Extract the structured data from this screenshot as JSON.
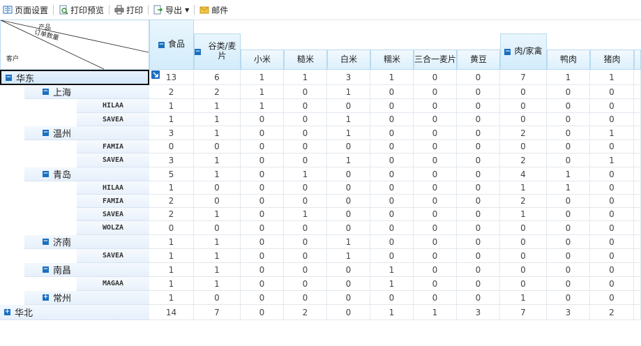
{
  "toolbar": {
    "page_setup": "页面设置",
    "print_preview": "打印预览",
    "print": "打印",
    "export": "导出",
    "mail": "邮件"
  },
  "corner": {
    "product": "产品",
    "order_count": "订单数量",
    "customer": "客户"
  },
  "columns": [
    "食品",
    "谷类/麦片",
    "小米",
    "糙米",
    "白米",
    "糯米",
    "三合一麦片",
    "黄豆",
    "肉/家禽",
    "鸭肉",
    "猪肉"
  ],
  "rows": [
    {
      "label": "华东",
      "level": 0,
      "expand": "minus",
      "values": [
        13,
        6,
        1,
        1,
        3,
        1,
        0,
        0,
        7,
        1,
        1
      ]
    },
    {
      "label": "上海",
      "level": 1,
      "expand": "minus",
      "values": [
        2,
        2,
        1,
        0,
        1,
        0,
        0,
        0,
        0,
        0,
        0
      ]
    },
    {
      "label": "HILAA",
      "level": 2,
      "values": [
        1,
        1,
        1,
        0,
        0,
        0,
        0,
        0,
        0,
        0,
        0
      ]
    },
    {
      "label": "SAVEA",
      "level": 2,
      "values": [
        1,
        1,
        0,
        0,
        1,
        0,
        0,
        0,
        0,
        0,
        0
      ]
    },
    {
      "label": "温州",
      "level": 1,
      "expand": "minus",
      "values": [
        3,
        1,
        0,
        0,
        1,
        0,
        0,
        0,
        2,
        0,
        1
      ]
    },
    {
      "label": "FAMIA",
      "level": 2,
      "values": [
        0,
        0,
        0,
        0,
        0,
        0,
        0,
        0,
        0,
        0,
        0
      ]
    },
    {
      "label": "SAVEA",
      "level": 2,
      "values": [
        3,
        1,
        0,
        0,
        1,
        0,
        0,
        0,
        2,
        0,
        1
      ]
    },
    {
      "label": "青岛",
      "level": 1,
      "expand": "minus",
      "values": [
        5,
        1,
        0,
        1,
        0,
        0,
        0,
        0,
        4,
        1,
        0
      ]
    },
    {
      "label": "HILAA",
      "level": 2,
      "values": [
        1,
        0,
        0,
        0,
        0,
        0,
        0,
        0,
        1,
        1,
        0
      ]
    },
    {
      "label": "FAMIA",
      "level": 2,
      "values": [
        2,
        0,
        0,
        0,
        0,
        0,
        0,
        0,
        2,
        0,
        0
      ]
    },
    {
      "label": "SAVEA",
      "level": 2,
      "values": [
        2,
        1,
        0,
        1,
        0,
        0,
        0,
        0,
        1,
        0,
        0
      ]
    },
    {
      "label": "WOLZA",
      "level": 2,
      "values": [
        0,
        0,
        0,
        0,
        0,
        0,
        0,
        0,
        0,
        0,
        0
      ]
    },
    {
      "label": "济南",
      "level": 1,
      "expand": "minus",
      "values": [
        1,
        1,
        0,
        0,
        1,
        0,
        0,
        0,
        0,
        0,
        0
      ]
    },
    {
      "label": "SAVEA",
      "level": 2,
      "values": [
        1,
        1,
        0,
        0,
        1,
        0,
        0,
        0,
        0,
        0,
        0
      ]
    },
    {
      "label": "南昌",
      "level": 1,
      "expand": "minus",
      "values": [
        1,
        1,
        0,
        0,
        0,
        1,
        0,
        0,
        0,
        0,
        0
      ]
    },
    {
      "label": "MAGAA",
      "level": 2,
      "values": [
        1,
        1,
        0,
        0,
        0,
        1,
        0,
        0,
        0,
        0,
        0
      ]
    },
    {
      "label": "常州",
      "level": 1,
      "expand": "plus",
      "values": [
        1,
        0,
        0,
        0,
        0,
        0,
        0,
        0,
        1,
        0,
        0
      ]
    },
    {
      "label": "华北",
      "level": 0,
      "expand": "plus",
      "values": [
        14,
        7,
        0,
        2,
        0,
        1,
        1,
        3,
        7,
        3,
        2
      ]
    }
  ],
  "colors": {
    "accent": "#1b6fc0",
    "header_bg": "#d3ecfb",
    "grid_line": "#e2e8ee"
  }
}
